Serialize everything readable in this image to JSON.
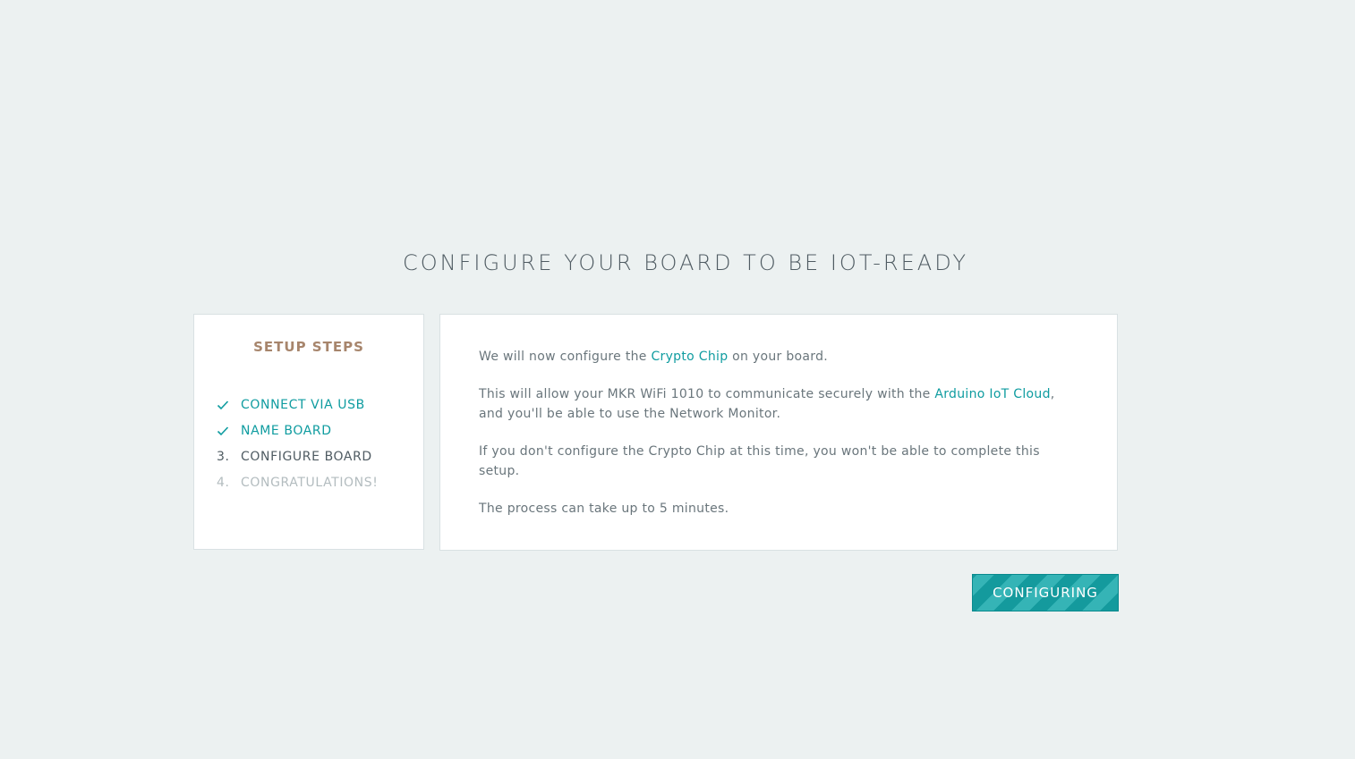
{
  "page": {
    "title": "CONFIGURE YOUR BOARD TO BE IOT-READY"
  },
  "steps": {
    "title": "SETUP STEPS",
    "items": [
      {
        "marker": "",
        "label": "CONNECT VIA USB",
        "status": "done"
      },
      {
        "marker": "",
        "label": "NAME BOARD",
        "status": "done"
      },
      {
        "marker": "3.",
        "label": "CONFIGURE BOARD",
        "status": "active"
      },
      {
        "marker": "4.",
        "label": "CONGRATULATIONS!",
        "status": "pending"
      }
    ]
  },
  "content": {
    "p1_before": "We will now configure the ",
    "p1_link": "Crypto Chip",
    "p1_after": " on your board.",
    "p2_before": "This will allow your MKR WiFi 1010 to communicate securely with the ",
    "p2_link": "Arduino IoT Cloud",
    "p2_after": ", and you'll be able to use the Network Monitor.",
    "p3": "If you don't configure the Crypto Chip at this time, you won't be able to complete this setup.",
    "p4": "The process can take up to 5 minutes."
  },
  "button": {
    "label": "CONFIGURING"
  },
  "icons": {
    "done_marker": "check-icon"
  },
  "colors": {
    "background": "#ecf1f1",
    "accent": "#0f9ca0",
    "steps_title": "#a7856c",
    "text": "#6a767c",
    "pending": "#b3bcbf"
  }
}
